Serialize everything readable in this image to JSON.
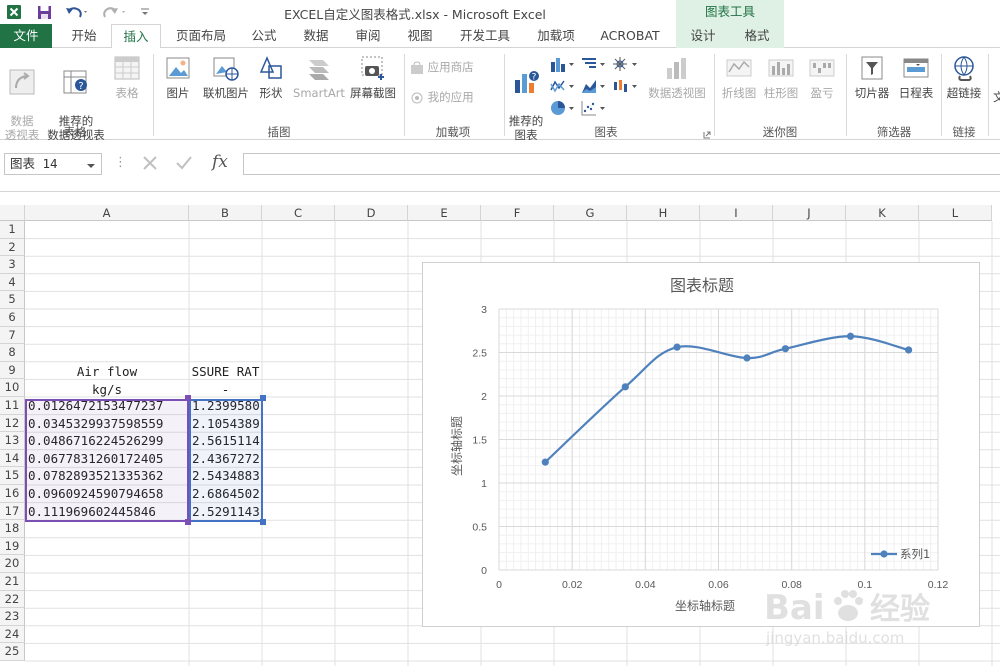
{
  "titlebar": {
    "title": "EXCEL自定义图表格式.xlsx - Microsoft Excel",
    "context_title": "图表工具"
  },
  "tabs": [
    {
      "label": "文件",
      "kind": "file"
    },
    {
      "label": "开始"
    },
    {
      "label": "插入",
      "kind": "active"
    },
    {
      "label": "页面布局"
    },
    {
      "label": "公式"
    },
    {
      "label": "数据"
    },
    {
      "label": "审阅"
    },
    {
      "label": "视图"
    },
    {
      "label": "开发工具"
    },
    {
      "label": "加载项"
    },
    {
      "label": "ACROBAT"
    },
    {
      "label": "设计",
      "kind": "ctx"
    },
    {
      "label": "格式",
      "kind": "ctx"
    }
  ],
  "ribbon": {
    "pivot_table": "数据\n透视表",
    "recommended_pivot": "推荐的\n数据透视表",
    "table": "表格",
    "group_tables": "表格",
    "picture": "图片",
    "online_picture": "联机图片",
    "shapes": "形状",
    "smartart": "SmartArt",
    "screenshot": "屏幕截图",
    "group_illustrations": "插图",
    "store": "应用商店",
    "my_apps": "我的应用",
    "group_addins": "加载项",
    "recommended_charts": "推荐的\n图表",
    "pivot_chart": "数据透视图",
    "group_charts": "图表",
    "spark_line": "折线图",
    "spark_column": "柱形图",
    "spark_winloss": "盈亏",
    "group_sparklines": "迷你图",
    "slicer": "切片器",
    "timeline": "日程表",
    "group_filters": "筛选器",
    "hyperlink": "超链接",
    "group_links": "链接",
    "text_partial": "文"
  },
  "formula_bar": {
    "name_box": "图表 14",
    "fx": "fx",
    "formula": ""
  },
  "grid": {
    "columns": [
      "A",
      "B",
      "C",
      "D",
      "E",
      "F",
      "G",
      "H",
      "I",
      "J",
      "K",
      "L"
    ],
    "rows": [
      "1",
      "2",
      "3",
      "4",
      "5",
      "6",
      "7",
      "8",
      "9",
      "10",
      "11",
      "12",
      "13",
      "14",
      "15",
      "16",
      "17",
      "18",
      "19",
      "20",
      "21",
      "22",
      "23",
      "24",
      "25"
    ],
    "header_a1": "Air flow",
    "header_b1": "SSURE RAT",
    "header_a2": "kg/s",
    "header_b2": "-",
    "col_a": [
      "0.0126472153477237",
      "0.0345329937598559",
      "0.0486716224526299",
      "0.0677831260172405",
      "0.0782893521335362",
      "0.0960924590794658",
      "0.111969602445846"
    ],
    "col_b": [
      "1.2399580",
      "2.1054389",
      "2.5615114",
      "2.4367272",
      "2.5434883",
      "2.6864502",
      "2.5291143"
    ]
  },
  "chart_data": {
    "type": "scatter",
    "title": "图表标题",
    "xlabel": "坐标轴标题",
    "ylabel": "坐标轴标题",
    "xlim": [
      0,
      0.12
    ],
    "ylim": [
      0,
      3
    ],
    "x_ticks": [
      "0",
      "0.02",
      "0.04",
      "0.06",
      "0.08",
      "0.1",
      "0.12"
    ],
    "y_ticks": [
      "0",
      "0.5",
      "1",
      "1.5",
      "2",
      "2.5",
      "3"
    ],
    "grid": true,
    "minor_grid": true,
    "smooth": true,
    "legend_position": "bottom-right",
    "series": [
      {
        "name": "系列1",
        "color": "#4f81bd",
        "x": [
          0.0126472153477237,
          0.0345329937598559,
          0.0486716224526299,
          0.0677831260172405,
          0.0782893521335362,
          0.0960924590794658,
          0.111969602445846
        ],
        "y": [
          1.239958,
          2.1054389,
          2.5615114,
          2.4367272,
          2.5434883,
          2.6864502,
          2.5291143
        ]
      }
    ]
  },
  "watermark": {
    "brand": "Bai",
    "brand_cn": "经验",
    "url": "jingyan.baidu.com"
  },
  "colors": {
    "excel_green": "#217346",
    "context_tab_bg": "#dff0e4",
    "range_purple": "#7b4fb3",
    "range_blue": "#4472c4",
    "series_blue": "#4f81bd"
  }
}
